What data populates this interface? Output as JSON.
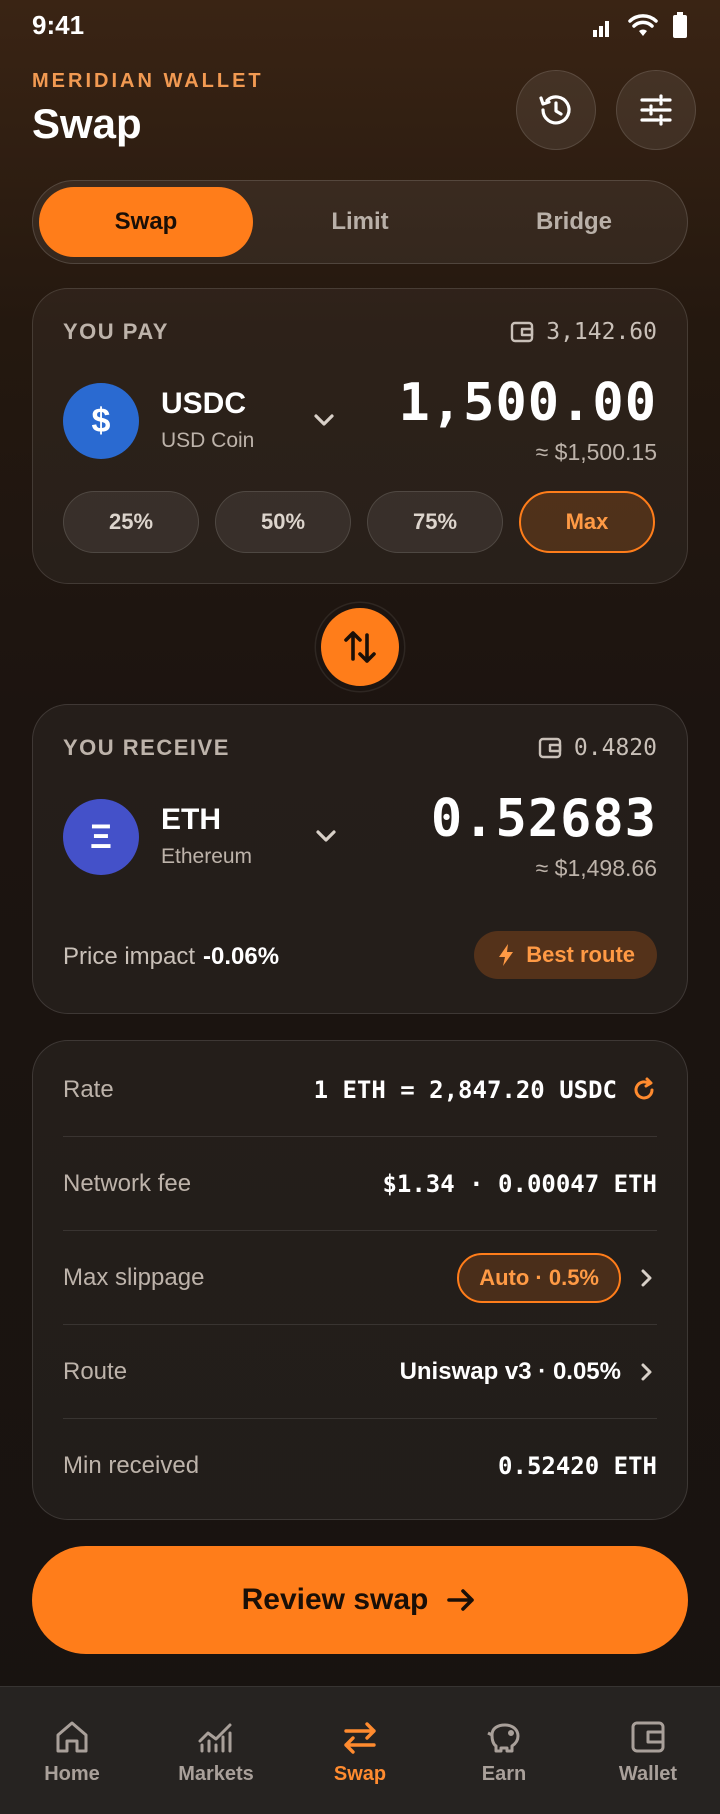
{
  "status_bar": {
    "time": "9:41"
  },
  "header": {
    "brand": "MERIDIAN WALLET",
    "title": "Swap"
  },
  "tabs": [
    {
      "label": "Swap",
      "active": true
    },
    {
      "label": "Limit",
      "active": false
    },
    {
      "label": "Bridge",
      "active": false
    }
  ],
  "pay": {
    "label": "YOU PAY",
    "balance": "3,142.60",
    "token_symbol": "USDC",
    "token_name": "USD Coin",
    "token_glyph": "$",
    "token_color": "#2a6ad1",
    "amount": "1,500.00",
    "amount_usd": "≈ $1,500.15",
    "percent_buttons": [
      "25%",
      "50%",
      "75%",
      "Max"
    ]
  },
  "receive": {
    "label": "YOU RECEIVE",
    "balance": "0.4820",
    "token_symbol": "ETH",
    "token_name": "Ethereum",
    "token_glyph": "Ξ",
    "token_color": "#4451c9",
    "amount": "0.52683",
    "amount_usd": "≈ $1,498.66",
    "price_impact_label": "Price impact",
    "price_impact_value": "-0.06%",
    "best_route_label": "Best route"
  },
  "details": {
    "rate_label": "Rate",
    "rate_value": "1 ETH = 2,847.20 USDC",
    "fee_label": "Network fee",
    "fee_value": "$1.34 · 0.00047 ETH",
    "slippage_label": "Max slippage",
    "slippage_value": "Auto · 0.5%",
    "route_label": "Route",
    "route_value": "Uniswap v3 · 0.05%",
    "min_label": "Min received",
    "min_value": "0.52420 ETH"
  },
  "cta": {
    "label": "Review swap"
  },
  "nav": [
    {
      "label": "Home",
      "icon": "home-icon",
      "active": false
    },
    {
      "label": "Markets",
      "icon": "markets-icon",
      "active": false
    },
    {
      "label": "Swap",
      "icon": "swap-icon",
      "active": true
    },
    {
      "label": "Earn",
      "icon": "piggy-bank-icon",
      "active": false
    },
    {
      "label": "Wallet",
      "icon": "wallet-icon",
      "active": false
    }
  ],
  "colors": {
    "accent": "#ff7d1a",
    "accent_text": "#ff9a45",
    "background": "#181310"
  }
}
